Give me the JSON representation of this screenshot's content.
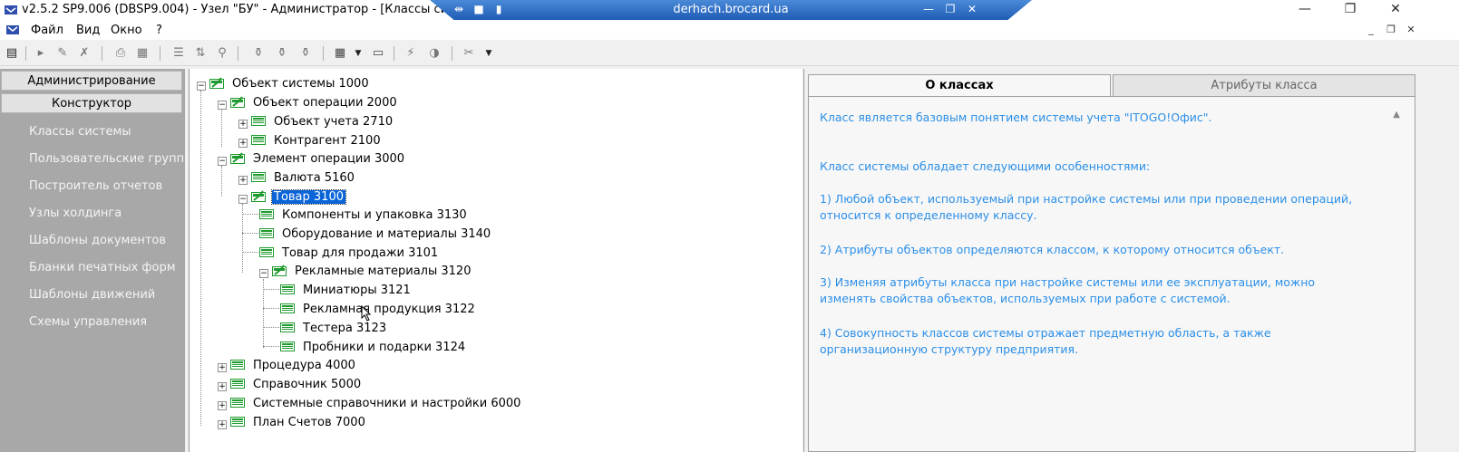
{
  "window": {
    "title": "v2.5.2 SP9.006 (DBSP9.004) - Узел \"БУ\" - Администратор - [Классы систем",
    "rdp_host": "derhach.brocard.ua",
    "minimize": "—",
    "restore": "❐",
    "close": "✕"
  },
  "menu": {
    "items": [
      "Файл",
      "Вид",
      "Окно",
      "?"
    ],
    "mdi_minimize": "_",
    "mdi_restore": "❐",
    "mdi_close": "✕"
  },
  "left_panel": {
    "group_buttons": [
      "Администрирование",
      "Конструктор"
    ],
    "nav_items": [
      "Классы системы",
      "Пользовательские группы...",
      "Построитель отчетов",
      "Узлы холдинга",
      "Шаблоны документов",
      "Бланки печатных форм",
      "Шаблоны движений",
      "Схемы управления"
    ]
  },
  "tree": {
    "nodes": [
      {
        "label": "Объект системы  1000",
        "expander": "−",
        "icon": "folder-class-icon"
      },
      {
        "label": "Объект операции  2000",
        "expander": "−",
        "icon": "folder-class-icon"
      },
      {
        "label": "Объект учета  2710",
        "expander": "+",
        "icon": "class-icon"
      },
      {
        "label": "Контрагент  2100",
        "expander": "+",
        "icon": "class-icon"
      },
      {
        "label": "Элемент операции  3000",
        "expander": "−",
        "icon": "folder-class-icon"
      },
      {
        "label": "Валюта  5160",
        "expander": "+",
        "icon": "class-icon"
      },
      {
        "label": "Товар  3100",
        "expander": "−",
        "icon": "folder-class-icon",
        "selected": true
      },
      {
        "label": "Компоненты и упаковка  3130",
        "expander": "",
        "icon": "class-icon"
      },
      {
        "label": "Оборудование и материалы  3140",
        "expander": "",
        "icon": "class-icon"
      },
      {
        "label": "Товар для продажи  3101",
        "expander": "",
        "icon": "class-icon"
      },
      {
        "label": "Рекламные материалы  3120",
        "expander": "−",
        "icon": "folder-class-icon"
      },
      {
        "label": "Миниатюры  3121",
        "expander": "",
        "icon": "class-icon"
      },
      {
        "label": "Рекламная продукция  3122",
        "expander": "",
        "icon": "class-icon"
      },
      {
        "label": "Тестера  3123",
        "expander": "",
        "icon": "class-icon"
      },
      {
        "label": "Пробники и подарки  3124",
        "expander": "",
        "icon": "class-icon"
      },
      {
        "label": "Процедура  4000",
        "expander": "+",
        "icon": "class-icon"
      },
      {
        "label": "Справочник  5000",
        "expander": "+",
        "icon": "class-icon"
      },
      {
        "label": "Системные справочники и настройки  6000",
        "expander": "+",
        "icon": "class-icon"
      },
      {
        "label": "План Счетов  7000",
        "expander": "+",
        "icon": "class-icon"
      }
    ]
  },
  "right_panel": {
    "tabs": [
      "О классах",
      "Атрибуты класса"
    ],
    "paragraphs": [
      "Класс является базовым понятием системы учета \"ITOGO!Офис\".",
      "Класс системы обладает следующими особенностями:",
      "1) Любой объект, используемый при настройке системы или при проведении операций, относится к определенному классу.",
      "2) Атрибуты объектов определяются классом, к которому относится объект.",
      "3) Изменяя атрибуты класса при настройке системы или ее эксплуатации, можно изменять свойства объектов, используемых при работе с системой.",
      "4) Совокупность классов системы отражает предметную область, а также организационную структуру предприятия."
    ]
  },
  "colors": {
    "accent_text": "#2b8fe8",
    "selection": "#0a64d8",
    "left_panel_bg": "#a8a8a8",
    "icon_green": "#1e9a2e"
  }
}
